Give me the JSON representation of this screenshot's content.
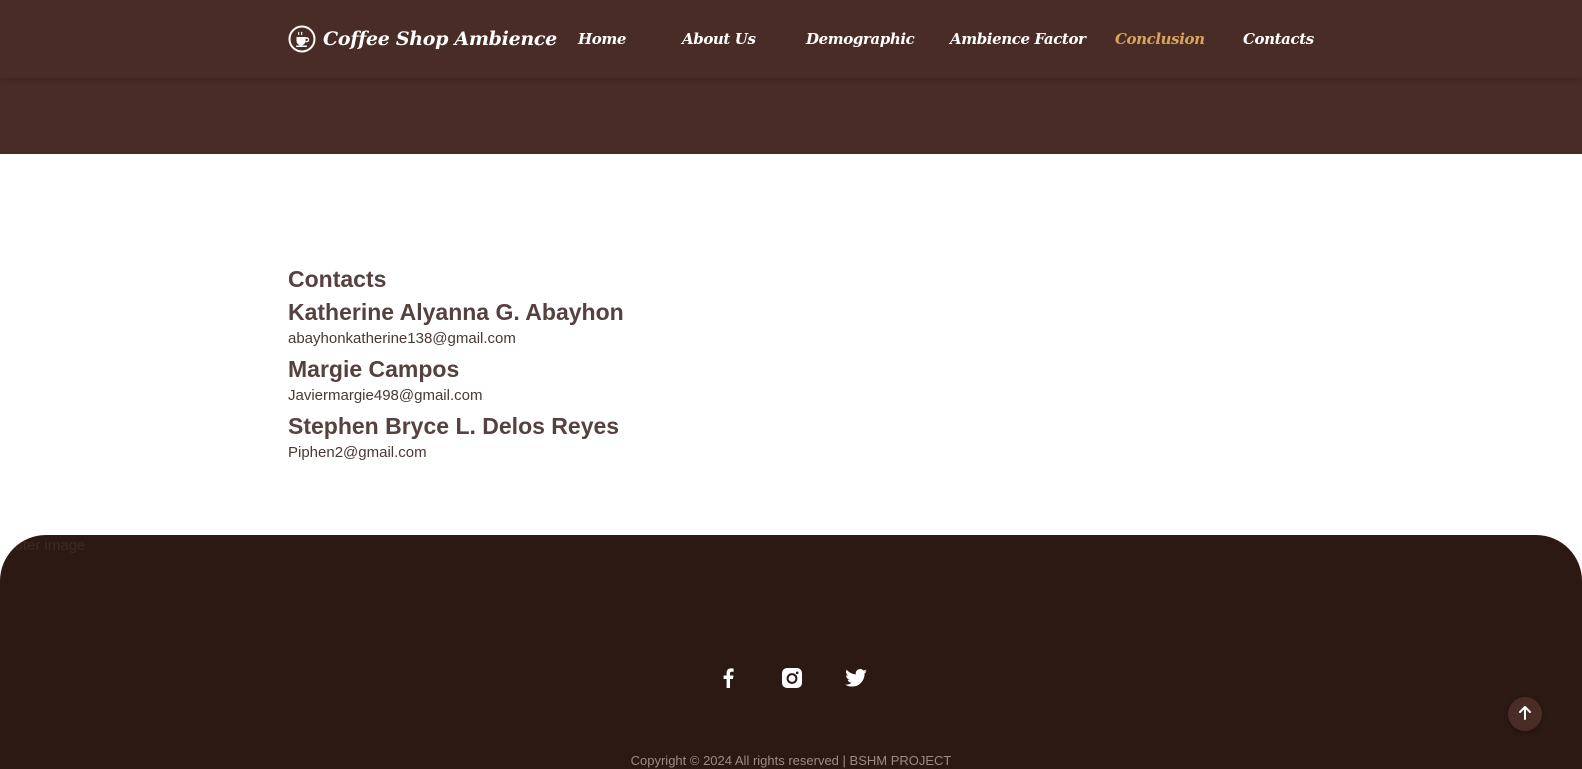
{
  "brand": {
    "title": "Coffee Shop Ambience",
    "logo_icon": "coffee-cup-icon"
  },
  "nav": {
    "items": [
      {
        "label": "Home",
        "active": false
      },
      {
        "label": "About Us",
        "active": false
      },
      {
        "label": "Demographic",
        "active": false
      },
      {
        "label": "Ambience Factor",
        "active": false
      },
      {
        "label": "Conclusion",
        "active": true
      },
      {
        "label": "Contacts",
        "active": false
      }
    ]
  },
  "contacts": {
    "heading": "Contacts",
    "people": [
      {
        "name": "Katherine Alyanna G. Abayhon",
        "email": "abayhonkatherine138@gmail.com"
      },
      {
        "name": "Margie Campos",
        "email": "Javiermargie498@gmail.com"
      },
      {
        "name": "Stephen Bryce L. Delos Reyes",
        "email": "Piphen2@gmail.com"
      }
    ]
  },
  "footer": {
    "image_alt": "footer image",
    "social_icons": [
      "facebook-icon",
      "instagram-icon",
      "twitter-icon"
    ],
    "copyright": "Copyright © 2024 All rights reserved | BSHM PROJECT"
  },
  "colors": {
    "header_bg": "#4a2c27",
    "accent": "#d9a45b",
    "footer_bg": "#2c1913",
    "text_dark": "#55413e"
  },
  "back_to_top_icon": "arrow-up-icon"
}
